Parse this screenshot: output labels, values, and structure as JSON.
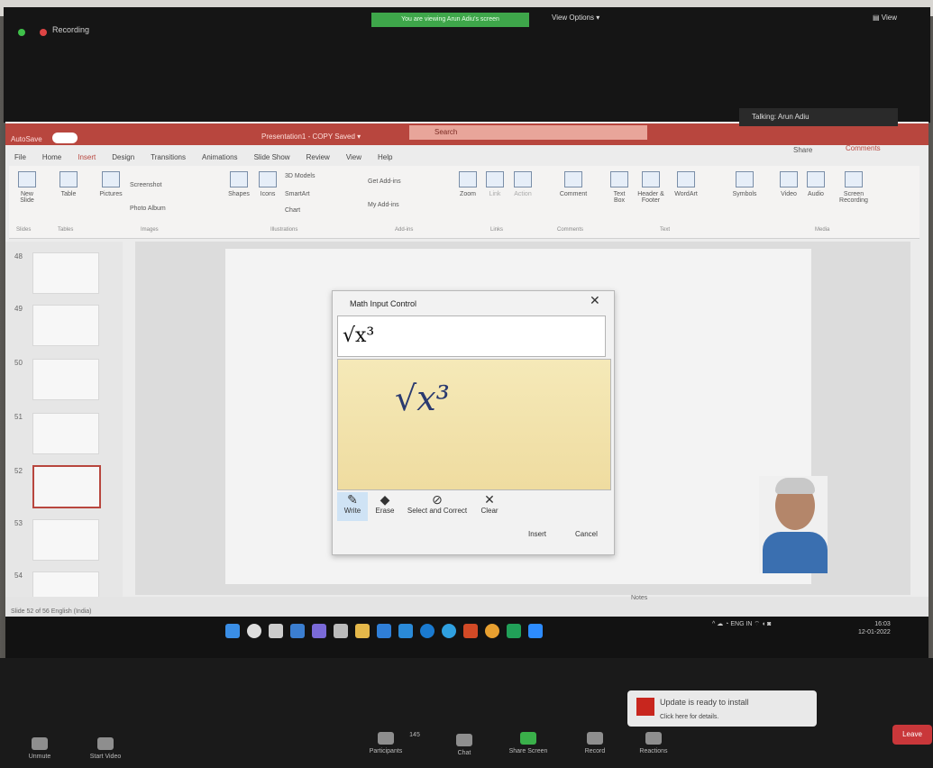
{
  "zoom": {
    "recording_label": "Recording",
    "viewing_banner": "You are viewing Arun Adiu's screen",
    "view_options": "View Options ▾",
    "view_button": "▤ View",
    "talking": "Talking: Arun Adiu",
    "bottom": {
      "unmute": "Unmute",
      "start_video": "Start Video",
      "participants": "Participants",
      "participants_count": "145",
      "chat": "Chat",
      "share_screen": "Share Screen",
      "record": "Record",
      "reactions": "Reactions",
      "leave": "Leave"
    }
  },
  "powerpoint": {
    "autosave": "AutoSave",
    "title": "Presentation1 - COPY  Saved ▾",
    "search": "Search",
    "share": "Share",
    "comments": "Comments",
    "menu_tabs": [
      "File",
      "Home",
      "Insert",
      "Design",
      "Transitions",
      "Animations",
      "Slide Show",
      "Review",
      "View",
      "Help"
    ],
    "active_tab": "Insert",
    "ribbon": {
      "new_slide": "New Slide",
      "table": "Table",
      "pictures": "Pictures",
      "screenshot": "Screenshot",
      "photo_album": "Photo Album",
      "shapes": "Shapes",
      "icons": "Icons",
      "models_3d": "3D Models",
      "smartart": "SmartArt",
      "chart": "Chart",
      "get_addins": "Get Add-ins",
      "my_addins": "My Add-ins",
      "zoom": "Zoom",
      "link": "Link",
      "action": "Action",
      "comment": "Comment",
      "text_box": "Text Box",
      "header_footer": "Header & Footer",
      "wordart": "WordArt",
      "symbols": "Symbols",
      "video": "Video",
      "audio": "Audio",
      "screen_recording": "Screen Recording",
      "groups": [
        "Slides",
        "Tables",
        "Images",
        "Illustrations",
        "Add-ins",
        "Links",
        "Comments",
        "Text",
        "Media"
      ]
    },
    "slide_numbers": [
      "48",
      "49",
      "50",
      "51",
      "52",
      "53",
      "54"
    ],
    "status_left": "Slide 52 of 56   English (India)",
    "status_right": "Notes"
  },
  "math_dialog": {
    "title": "Math Input Control",
    "close": "✕",
    "preview": "√x³",
    "handwritten": "√x³",
    "tools": {
      "write": "Write",
      "erase": "Erase",
      "select_correct": "Select and Correct",
      "clear": "Clear"
    },
    "insert": "Insert",
    "cancel": "Cancel"
  },
  "taskbar": {
    "tray": "^ ☁ ◔  ENG IN  ⌔ ◖ ◙",
    "time": "16:03",
    "date": "12-01-2022"
  },
  "toast": {
    "title": "Update is ready to install",
    "subtitle": "Click here for details."
  }
}
